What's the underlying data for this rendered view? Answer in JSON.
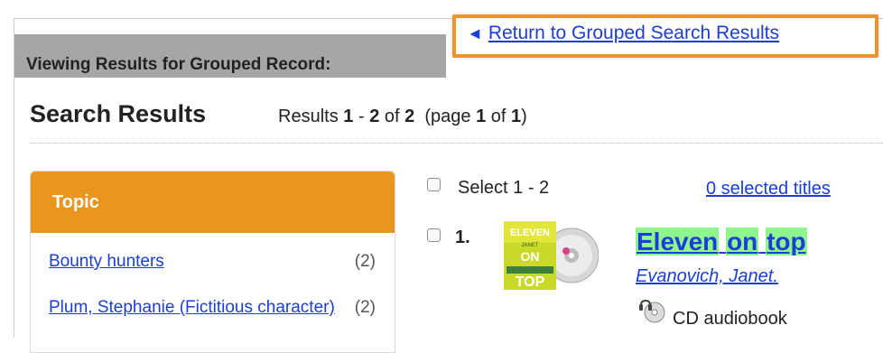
{
  "grouped": {
    "label": "Viewing Results for Grouped Record:",
    "return_arrow": "◄",
    "return_link": "Return to Grouped Search Results"
  },
  "search": {
    "heading": "Search Results",
    "results_prefix": "Results",
    "range_start": "1",
    "range_sep": "-",
    "range_end": "2",
    "of_word": "of",
    "total": "2",
    "page_prefix": "(page",
    "page_num": "1",
    "page_of": "of",
    "page_total": "1",
    "page_suffix": ")"
  },
  "facet": {
    "title": "Topic",
    "items": [
      {
        "label": "Bounty hunters",
        "count": "(2)"
      },
      {
        "label": "Plum, Stephanie (Fictitious character)",
        "count": "(2)"
      }
    ]
  },
  "selection": {
    "select_label": "Select 1 - 2",
    "selected_titles": "0 selected titles"
  },
  "result": {
    "number": "1.",
    "title_words": [
      "Eleven",
      "on",
      "top"
    ],
    "author": "Evanovich, Janet.",
    "format": "CD audiobook",
    "cover_text": [
      "ELEVEN",
      "JANET",
      "ON",
      "TOP"
    ]
  },
  "colors": {
    "accent_orange": "#e8961e",
    "highlight_box": "#f0932b",
    "link_blue": "#1a3ed6",
    "title_highlight": "#8ff58f",
    "grouped_bar": "#a6a6a6"
  }
}
